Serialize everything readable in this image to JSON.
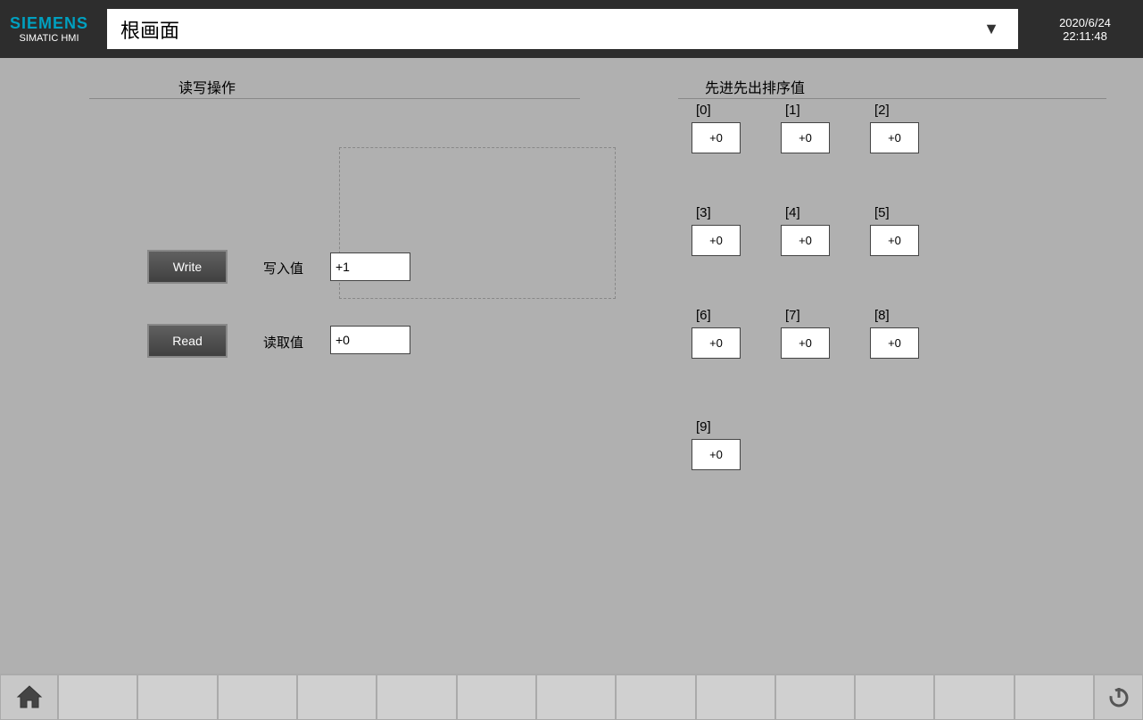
{
  "topbar": {
    "siemens_label": "SIEMENS",
    "simatic_label": "SIMATIC HMI",
    "title": "根画面",
    "dropdown_arrow": "▼",
    "date": "2020/6/24",
    "time": "22:11:48"
  },
  "rw_section": {
    "title": "读写操作",
    "write_button_label": "Write",
    "write_field_label": "写入值",
    "write_value": "+1",
    "read_button_label": "Read",
    "read_field_label": "读取值",
    "read_value": "+0"
  },
  "fifo_section": {
    "title": "先进先出排序值",
    "indices": [
      "[0]",
      "[1]",
      "[2]",
      "[3]",
      "[4]",
      "[5]",
      "[6]",
      "[7]",
      "[8]",
      "[9]"
    ],
    "values": [
      "+0",
      "+0",
      "+0",
      "+0",
      "+0",
      "+0",
      "+0",
      "+0",
      "+0",
      "+0"
    ]
  },
  "taskbar": {
    "home_label": "Home",
    "power_label": "Power",
    "empty_buttons": 13
  }
}
